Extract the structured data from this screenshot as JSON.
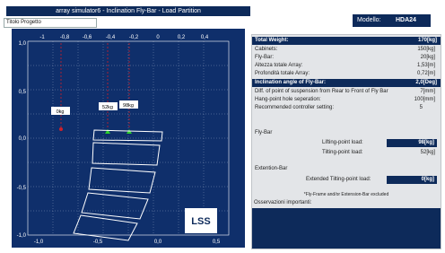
{
  "window": {
    "title": "array simulator6 - Inclination Fly-Bar - Load Partition"
  },
  "subtitle": "Titolo Progetto",
  "model": {
    "label": "Modello:",
    "value": "HDA24"
  },
  "chart": {
    "x_ticks": [
      "-1",
      "-0,8",
      "-0,6",
      "-0,4",
      "-0,2",
      "0",
      "0,2",
      "0,4"
    ],
    "x_ticks_bottom": [
      "-1,0",
      "-0,5",
      "0,0",
      "0,5"
    ],
    "y_ticks": [
      "1,0",
      "0,5",
      "0,0",
      "-0,5",
      "-1,0"
    ],
    "load_labels": [
      "0kg",
      "52kg",
      "98kg"
    ],
    "logo": "LSS"
  },
  "weights": {
    "total": {
      "label": "Total Weight:",
      "value": "170[kg]"
    },
    "cabinets": {
      "label": "Cabinets:",
      "value": "150[kg]"
    },
    "flybar": {
      "label": "Fly-Bar:",
      "value": "20[kg]"
    },
    "height": {
      "label": "Altezza totale Array:",
      "value": "1,53[m]"
    },
    "depth": {
      "label": "Profondità totale Array:",
      "value": "0,72[m]"
    }
  },
  "inclination": {
    "header_label": "Inclination angle of Fly-Bar:",
    "header_value": "2,0[Deg]",
    "diff_label": "Diff. of point of suspension from Rear to Front of Fly Bar",
    "diff_value": "7[mm]",
    "hang_label": "Hang-point hole seperation:",
    "hang_value": "100[mm]",
    "controller_label": "Recommended controller setting:",
    "controller_value": "5"
  },
  "flybar_section": {
    "title": "Fly-Bar",
    "lifting_label": "Lifting-point load:",
    "lifting_value": "98[kg]",
    "tilting_label": "Tilting-point load:",
    "tilting_value": "52[kg]"
  },
  "extension": {
    "title": "Extention-Bar",
    "label": "Extended Tilting-point load:",
    "value": "0[kg]"
  },
  "note": "*Fly-Frame and/or Extension-Bar excluded",
  "observations_label": "Osservazioni importanti:"
}
